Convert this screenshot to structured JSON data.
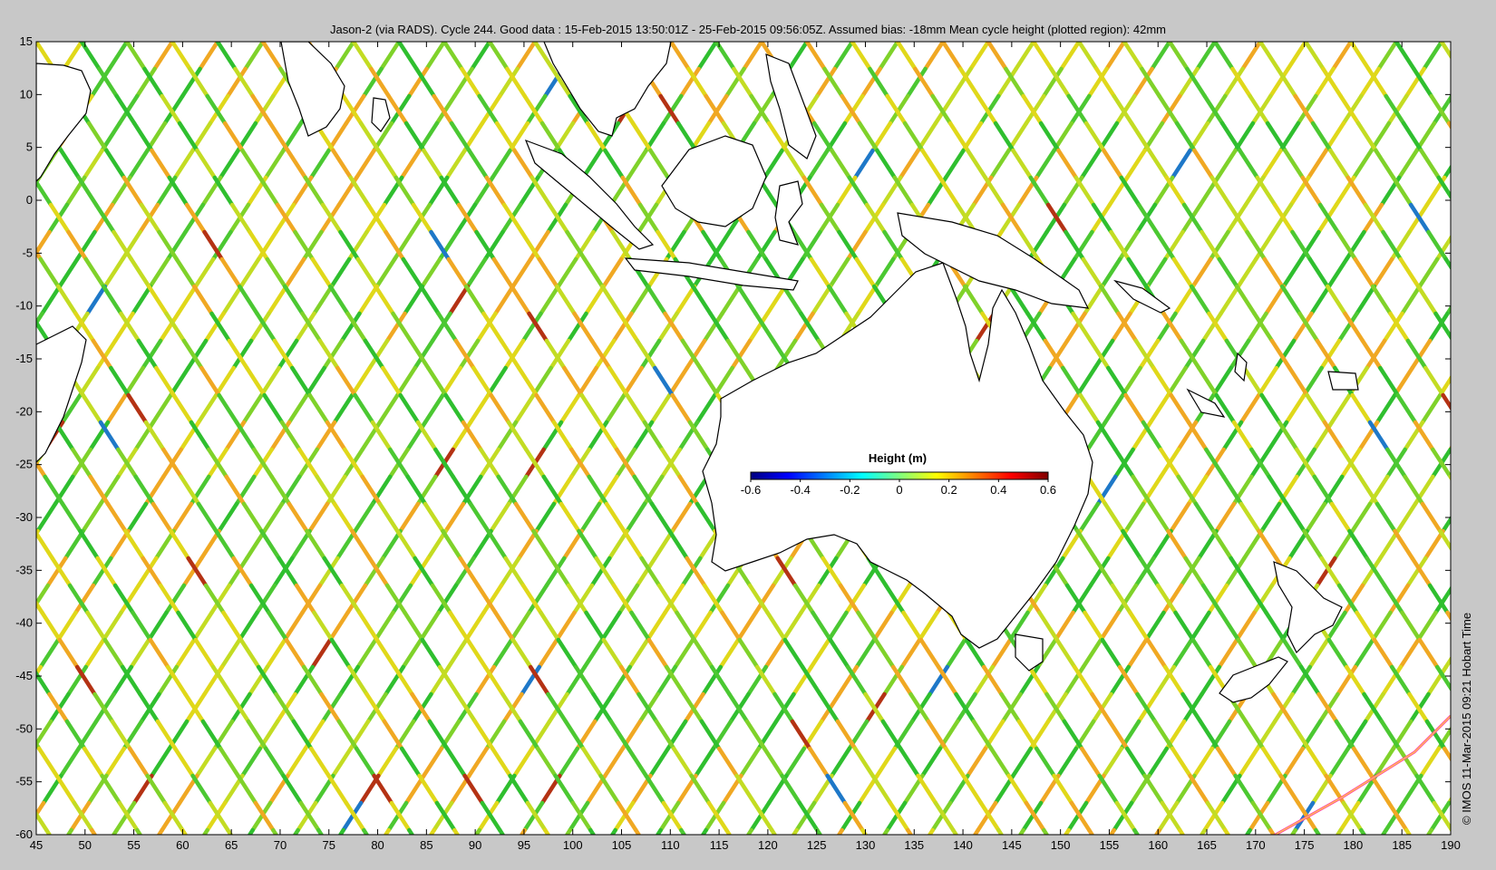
{
  "title": "Jason-2 (via RADS). Cycle 244. Good data : 15-Feb-2015 13:50:01Z - 25-Feb-2015 09:56:05Z. Assumed bias: -18mm  Mean cycle height (plotted region): 42mm",
  "side_label": "© IMOS 11-Mar-2015 09:21 Hobart Time",
  "chart_data": {
    "type": "map",
    "xlim": [
      45,
      190
    ],
    "ylim": [
      -60,
      15
    ],
    "xticks": [
      "45",
      "50",
      "55",
      "60",
      "65",
      "70",
      "75",
      "80",
      "85",
      "90",
      "95",
      "100",
      "105",
      "110",
      "115",
      "120",
      "125",
      "130",
      "135",
      "140",
      "145",
      "150",
      "155",
      "160",
      "165",
      "170",
      "175",
      "180",
      "185",
      "190"
    ],
    "yticks": [
      "15",
      "10",
      "5",
      "0",
      "-5",
      "-10",
      "-15",
      "-20",
      "-25",
      "-30",
      "-35",
      "-40",
      "-45",
      "-50",
      "-55",
      "-60"
    ],
    "grid": false,
    "colorbar": {
      "title": "Height (m)",
      "range": [
        -0.6,
        0.6
      ],
      "ticks": [
        "-0.6",
        "-0.4",
        "-0.2",
        "0",
        "0.2",
        "0.4",
        "0.6"
      ],
      "colormap": [
        "#00007f",
        "#0000ff",
        "#007fff",
        "#00ffff",
        "#7fff7f",
        "#ffff00",
        "#ff7f00",
        "#ff0000",
        "#7f0000"
      ]
    },
    "track_colors": {
      "typical": [
        "#2fbf2f",
        "#4bc832",
        "#7fd22a",
        "#c3dc23",
        "#e0d81a",
        "#f0a823"
      ],
      "anomaly_high": "#b43214",
      "anomaly_low": "#1e78c8"
    }
  }
}
